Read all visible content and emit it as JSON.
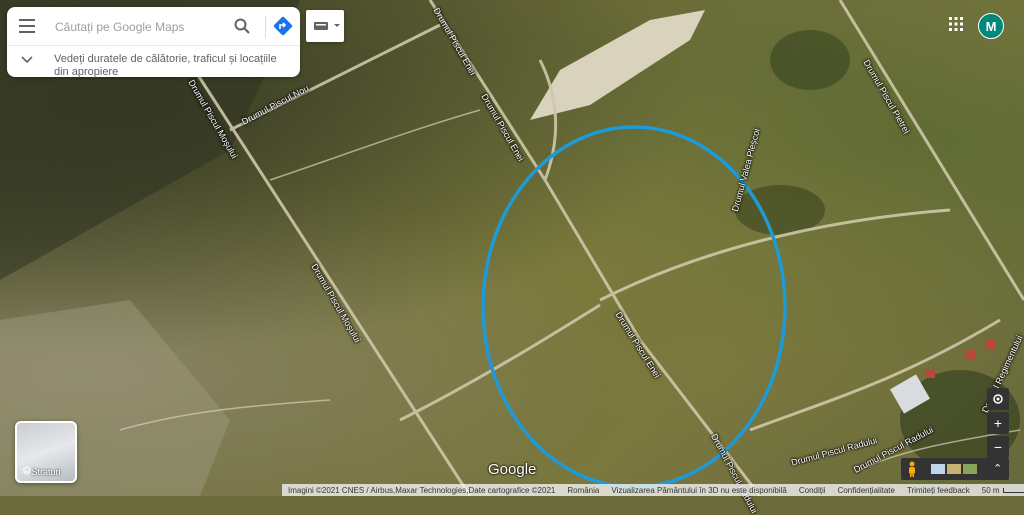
{
  "search": {
    "placeholder": "Căutați pe Google Maps",
    "suggestion": "Vedeți duratele de călătorie, traficul și locațiile din apropiere"
  },
  "user": {
    "avatar_letter": "M"
  },
  "layers": {
    "label": "Straturi"
  },
  "map": {
    "streets": [
      "Drumul Piscul Nou",
      "Drumul Piscul Moșului",
      "Drumul Piscul Moșului",
      "Drumul Piscul Enei",
      "Drumul Piscul Enei",
      "Drumul Piscul Enei",
      "Drumul Valea Pleșcoi",
      "Drumul Piscul Pietrei",
      "Drumul Piscul Radului",
      "Drumul Piscul Radului",
      "Drumul Piscul Radului",
      "Drumul Regimentului"
    ],
    "highlight_color": "#1e9ad6",
    "logo": "Google"
  },
  "controls": {
    "zoom_in": "+",
    "zoom_out": "−"
  },
  "footer": {
    "imagery": "Imagini ©2021 CNES / Airbus,Maxar Technologies,Date cartografice ©2021",
    "country": "România",
    "notice_3d": "Vizualizarea Pământului în 3D nu este disponibilă",
    "terms": "Condiții",
    "privacy": "Confidențialitate",
    "feedback": "Trimiteți feedback",
    "scale": "50 m"
  }
}
